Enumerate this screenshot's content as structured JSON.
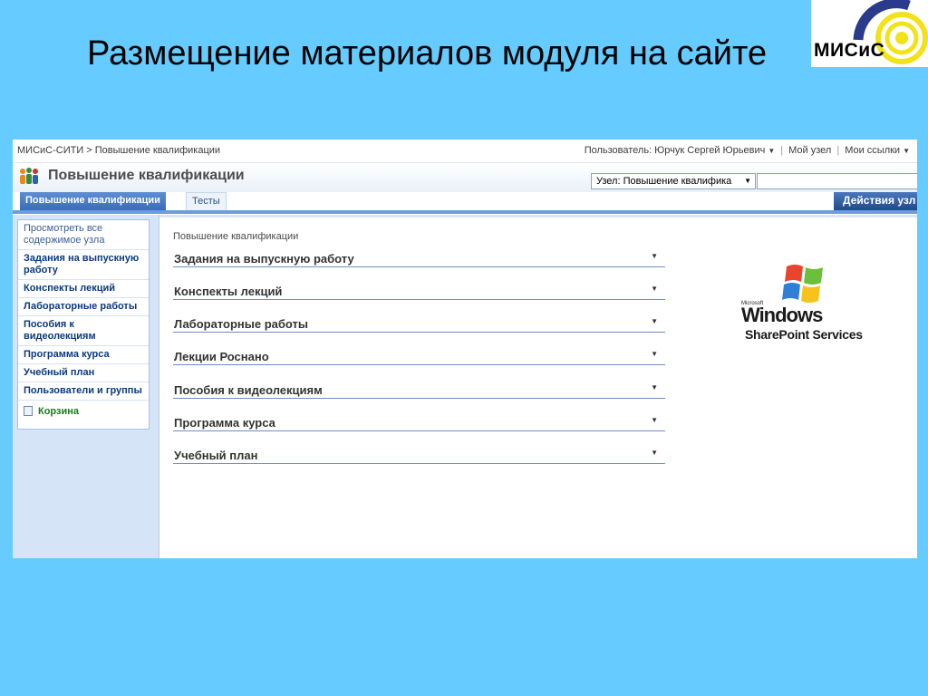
{
  "slide": {
    "title": "Размещение материалов модуля на сайте"
  },
  "logo": {
    "text": "МИСиС"
  },
  "topbar": {
    "breadcrumb": "МИСиС-СИТИ > Повышение квалификации",
    "user": "Пользователь: Юрчук Сергей Юрьевич",
    "my_site": "Мой узел",
    "my_links": "Мои ссылки"
  },
  "header": {
    "title": "Повышение квалификации",
    "scope_select": "Узел: Повышение квалифика",
    "search_placeholder": ""
  },
  "tabs": [
    {
      "label": "Повышение квалификации"
    },
    {
      "label": "Тесты"
    }
  ],
  "actions": {
    "label": "Действия узл"
  },
  "leftnav": {
    "view_all": "Просмотреть все содержимое узла",
    "items": [
      {
        "label": "Задания на выпускную работу"
      },
      {
        "label": "Конспекты лекций"
      },
      {
        "label": "Лабораторные работы"
      },
      {
        "label": "Пособия к видеолекциям"
      },
      {
        "label": "Программа курса"
      },
      {
        "label": "Учебный план"
      },
      {
        "label": "Пользователи и группы"
      }
    ],
    "recycle": "Корзина"
  },
  "content": {
    "title": "Повышение квалификации",
    "webparts": [
      {
        "title": "Задания на выпускную работу"
      },
      {
        "title": "Конспекты лекций"
      },
      {
        "title": "Лабораторные работы"
      },
      {
        "title": "Лекции Роснано"
      },
      {
        "title": "Пособия к видеолекциям"
      },
      {
        "title": "Программа курса"
      },
      {
        "title": "Учебный план"
      }
    ]
  },
  "ms_logo": {
    "microsoft": "Microsoft",
    "windows": "Windows",
    "product": "SharePoint Services"
  },
  "colors": {
    "slide_background": "#66ccff",
    "tab_active": "#3a6cb8",
    "nav_link": "#0b3a7e",
    "recycle_link": "#1c7a1c"
  }
}
